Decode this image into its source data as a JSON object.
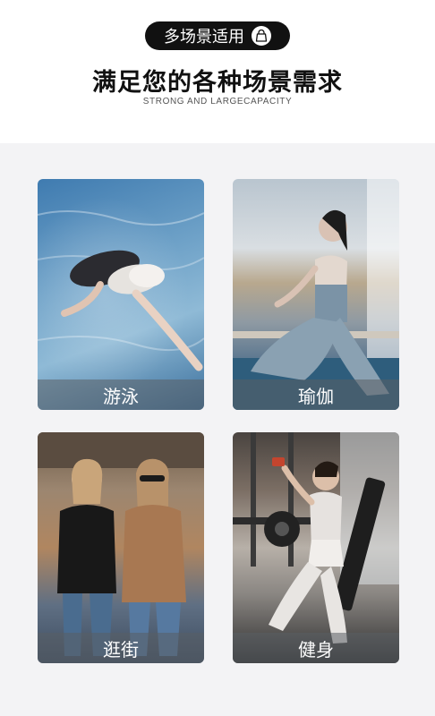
{
  "header": {
    "pill_label": "多场景适用",
    "pill_icon": "shopping-bag-icon",
    "title": "满足您的各种场景需求",
    "subtitle": "STRONG AND LARGECAPACITY"
  },
  "scenes": [
    {
      "label": "游泳",
      "photo": "swimming-photo"
    },
    {
      "label": "瑜伽",
      "photo": "yoga-photo"
    },
    {
      "label": "逛街",
      "photo": "shopping-street-photo"
    },
    {
      "label": "健身",
      "photo": "gym-fitness-photo"
    }
  ],
  "colors": {
    "background": "#ffffff",
    "panel": "#f3f3f5",
    "pill": "#111111",
    "caption_overlay": "#5a5f64"
  }
}
